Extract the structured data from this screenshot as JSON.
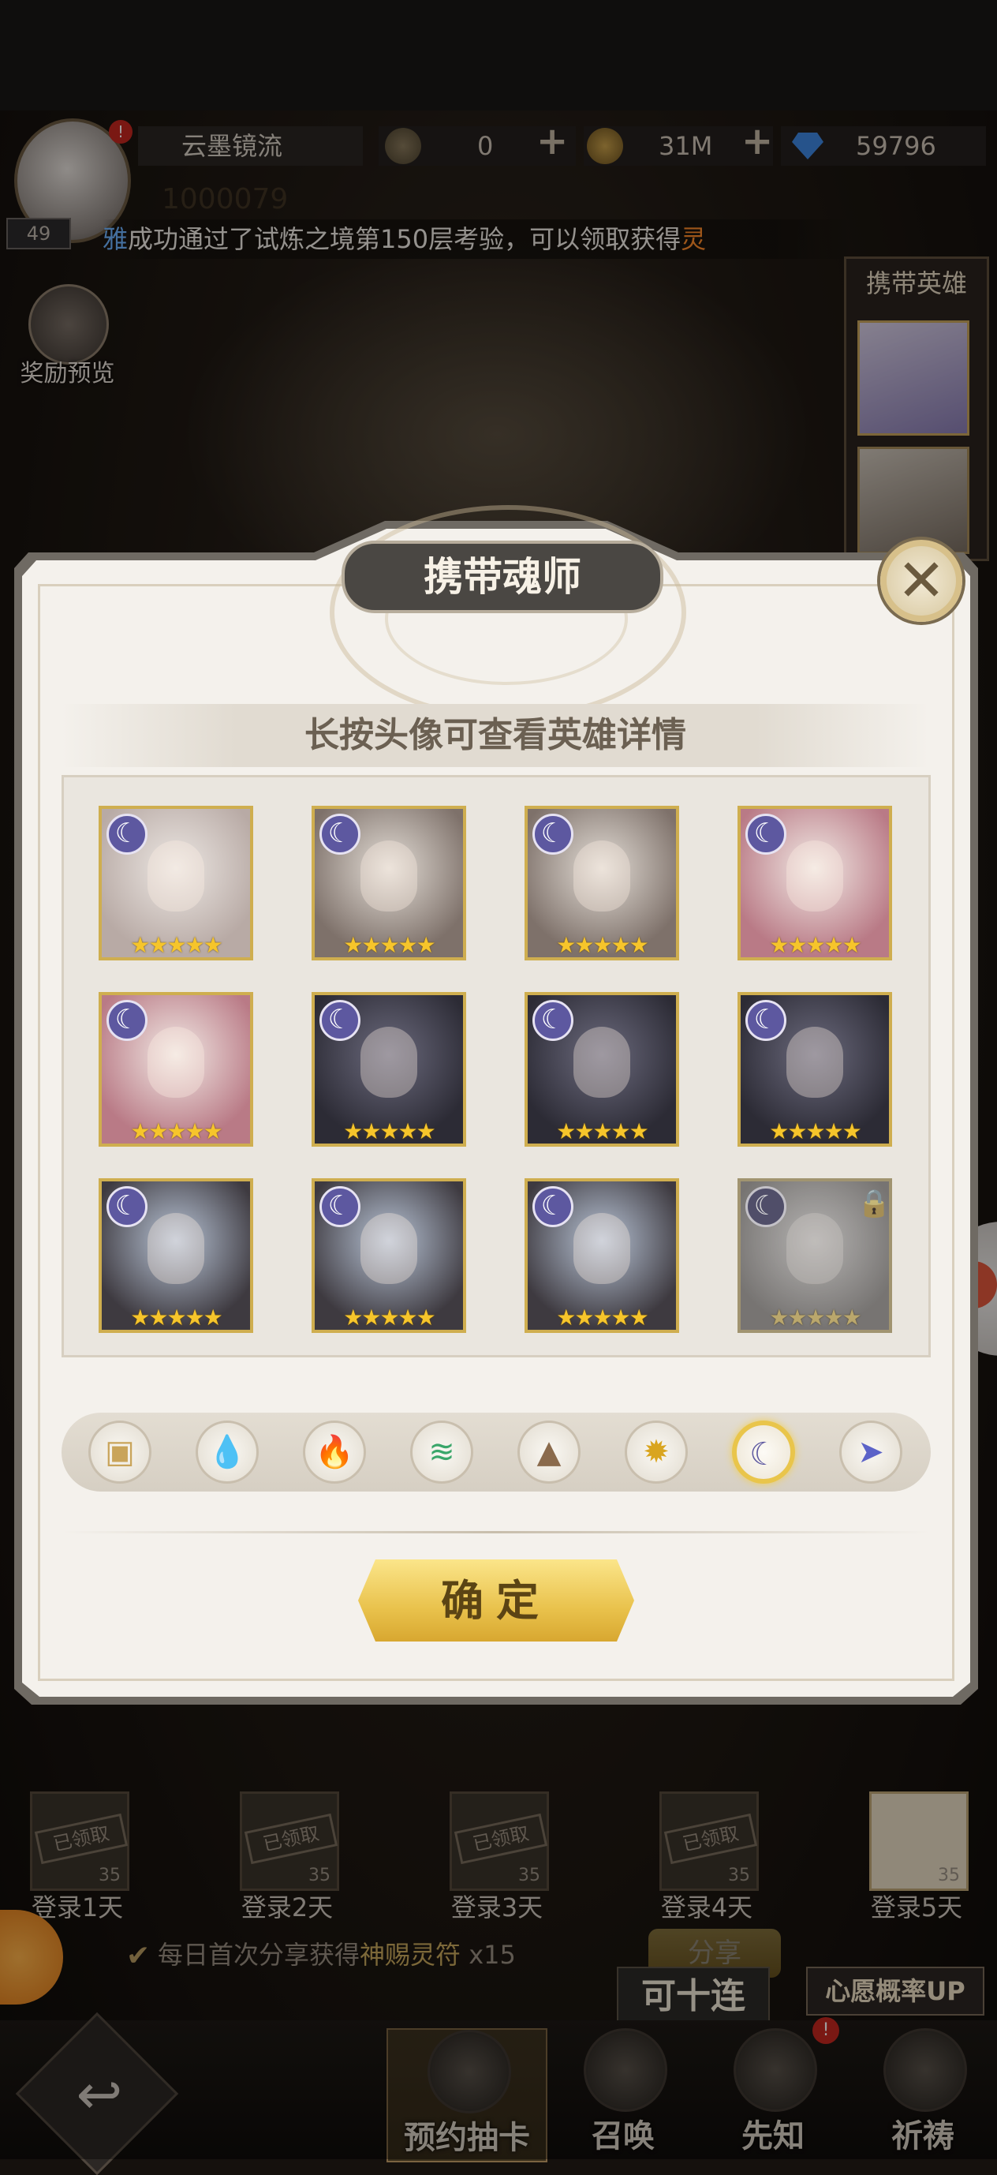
{
  "hud": {
    "player_name": "云墨镜流",
    "player_id": "1000079",
    "level": "49",
    "avatar_alert": "!",
    "resource_1": "0",
    "resource_2": "31M",
    "resource_3": "59796",
    "plus": "+"
  },
  "marquee": {
    "name": "雅",
    "text": "成功通过了试炼之境第150层考验，可以领取获得",
    "tail": "灵"
  },
  "reward_preview": "奖励预览",
  "carry_hero_panel": {
    "title": "携带英雄"
  },
  "modal": {
    "title": "携带魂师",
    "close_glyph": "✕",
    "subtitle": "长按头像可查看英雄详情",
    "confirm_label": "确定"
  },
  "heroes": [
    {
      "stars": "★★★★★",
      "element": "moon",
      "palette": [
        "#ece7e3",
        "#b8aaa5"
      ],
      "locked": false
    },
    {
      "stars": "★★★★★",
      "element": "moon",
      "palette": [
        "#e3ddd6",
        "#7e716a"
      ],
      "locked": false
    },
    {
      "stars": "★★★★★",
      "element": "moon",
      "palette": [
        "#e3ddd6",
        "#7e716a"
      ],
      "locked": false
    },
    {
      "stars": "★★★★★",
      "element": "moon",
      "palette": [
        "#f1e9e4",
        "#b97a86"
      ],
      "locked": false
    },
    {
      "stars": "★★★★★",
      "element": "moon",
      "palette": [
        "#f1e9e4",
        "#b97a86"
      ],
      "locked": false
    },
    {
      "stars": "★★★★★",
      "element": "moon",
      "palette": [
        "#6b6a7d",
        "#2c2b35"
      ],
      "locked": false
    },
    {
      "stars": "★★★★★",
      "element": "moon",
      "palette": [
        "#6b6a7d",
        "#2c2b35"
      ],
      "locked": false
    },
    {
      "stars": "★★★★★",
      "element": "moon",
      "palette": [
        "#6b6a7d",
        "#2c2b35"
      ],
      "locked": false
    },
    {
      "stars": "★★★★★",
      "element": "moon",
      "palette": [
        "#b8c4d6",
        "#3e3a40"
      ],
      "locked": false
    },
    {
      "stars": "★★★★★",
      "element": "moon",
      "palette": [
        "#b8c4d6",
        "#3e3a40"
      ],
      "locked": false
    },
    {
      "stars": "★★★★★",
      "element": "moon",
      "palette": [
        "#b8c4d6",
        "#3e3a40"
      ],
      "locked": false
    },
    {
      "stars": "★★★★★",
      "element": "moon",
      "palette": [
        "#d7d2cf",
        "#8f8883"
      ],
      "locked": true
    }
  ],
  "element_filters": [
    {
      "icon": "box-icon",
      "glyph": "▣",
      "color": "#c9a45a",
      "active": false
    },
    {
      "icon": "water-icon",
      "glyph": "💧",
      "color": "#3e8ed8",
      "active": false
    },
    {
      "icon": "fire-icon",
      "glyph": "🔥",
      "color": "#d84a2e",
      "active": false
    },
    {
      "icon": "wind-icon",
      "glyph": "≋",
      "color": "#3aa66a",
      "active": false
    },
    {
      "icon": "earth-icon",
      "glyph": "▲",
      "color": "#8a6a4c",
      "active": false
    },
    {
      "icon": "light-icon",
      "glyph": "✹",
      "color": "#d9a520",
      "active": false
    },
    {
      "icon": "moon-icon",
      "glyph": "☾",
      "color": "#5d58a0",
      "active": true
    },
    {
      "icon": "arrow-icon",
      "glyph": "➤",
      "color": "#5c63c8",
      "active": false
    }
  ],
  "login": {
    "claimed": "已领取",
    "days": [
      {
        "label": "登录1天",
        "count": "35"
      },
      {
        "label": "登录2天",
        "count": "35"
      },
      {
        "label": "登录3天",
        "count": "35"
      },
      {
        "label": "登录4天",
        "count": "35"
      },
      {
        "label": "登录5天",
        "count": "35"
      }
    ]
  },
  "share": {
    "text_a": "每日首次分享获得",
    "text_b": "神赐灵符",
    "text_c": " x15",
    "button": "分享"
  },
  "ten_pull": "可十连",
  "wish_up": "心愿概率UP",
  "nav": {
    "reserve": "预约抽卡",
    "summon": "召唤",
    "prophet": "先知",
    "pray": "祈祷",
    "back_glyph": "↩",
    "alert": "!"
  }
}
